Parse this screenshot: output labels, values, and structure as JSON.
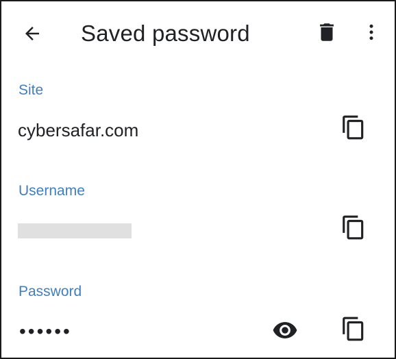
{
  "header": {
    "title": "Saved password",
    "back_icon": "arrow-back-icon",
    "delete_icon": "trash-icon",
    "more_icon": "more-vert-icon"
  },
  "site": {
    "label": "Site",
    "value": "cybersafar.com",
    "copy_icon": "copy-icon"
  },
  "username": {
    "label": "Username",
    "value": "",
    "copy_icon": "copy-icon"
  },
  "password": {
    "label": "Password",
    "value": "••••••",
    "show_icon": "eye-icon",
    "copy_icon": "copy-icon"
  },
  "colors": {
    "accent": "#3f7ec3",
    "text": "#202124",
    "icon": "#202124",
    "mask": "#e0e0e0"
  }
}
